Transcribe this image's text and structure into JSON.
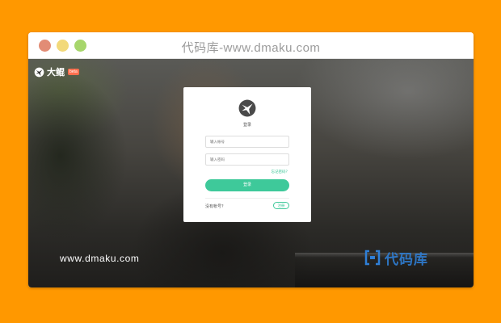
{
  "window": {
    "title": "代码库-www.dmaku.com"
  },
  "brand": {
    "name": "大鲲",
    "badge": "beta",
    "logo_icon": "bird-logo-icon"
  },
  "login": {
    "title": "登录",
    "username_placeholder": "输入帐号",
    "password_placeholder": "输入密码",
    "forgot_label": "忘记密码？",
    "login_label": "登录",
    "no_account_label": "没有帐号？",
    "register_label": "注册",
    "accent_color": "#3ec99a"
  },
  "watermark": {
    "url": "www.dmaku.com",
    "logo_text": "代码库",
    "logo_color": "#2f7fd6"
  },
  "colors": {
    "page_background": "#ff9800"
  }
}
